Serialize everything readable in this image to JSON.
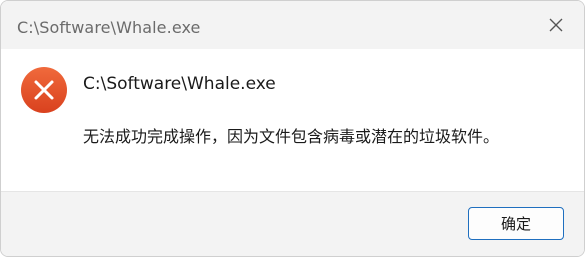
{
  "window": {
    "title": "C:\\Software\\Whale.exe",
    "close_icon": "close-icon"
  },
  "content": {
    "icon": "error-icon",
    "icon_color": "#e8552d",
    "heading": "C:\\Software\\Whale.exe",
    "message": "无法成功完成操作，因为文件包含病毒或潜在的垃圾软件。"
  },
  "footer": {
    "ok_label": "确定",
    "accent_color": "#1f6fbf"
  }
}
